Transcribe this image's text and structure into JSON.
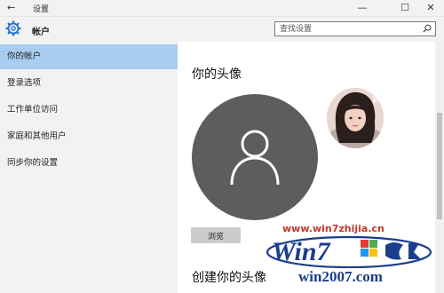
{
  "window": {
    "title": "设置",
    "back_glyph": "←",
    "minimize_glyph": "—",
    "maximize_glyph": "☐",
    "close_glyph": "✕"
  },
  "header": {
    "title": "帐户",
    "search_placeholder": "查找设置",
    "icon": "gear-icon",
    "accent_color": "#1f6fd6"
  },
  "sidebar": {
    "items": [
      {
        "label": "你的帐户",
        "active": true
      },
      {
        "label": "登录选项",
        "active": false
      },
      {
        "label": "工作单位访问",
        "active": false
      },
      {
        "label": "家庭和其他用户",
        "active": false
      },
      {
        "label": "同步你的设置",
        "active": false
      }
    ],
    "active_color": "#a9cdf0"
  },
  "main": {
    "avatar_title": "你的头像",
    "browse_label": "浏览",
    "create_title": "创建你的头像",
    "placeholder_icon": "person-icon"
  },
  "watermark": {
    "url": "www.win7zhijia.cn",
    "brand": "Win7",
    "bottom_text": "win2007.com"
  }
}
